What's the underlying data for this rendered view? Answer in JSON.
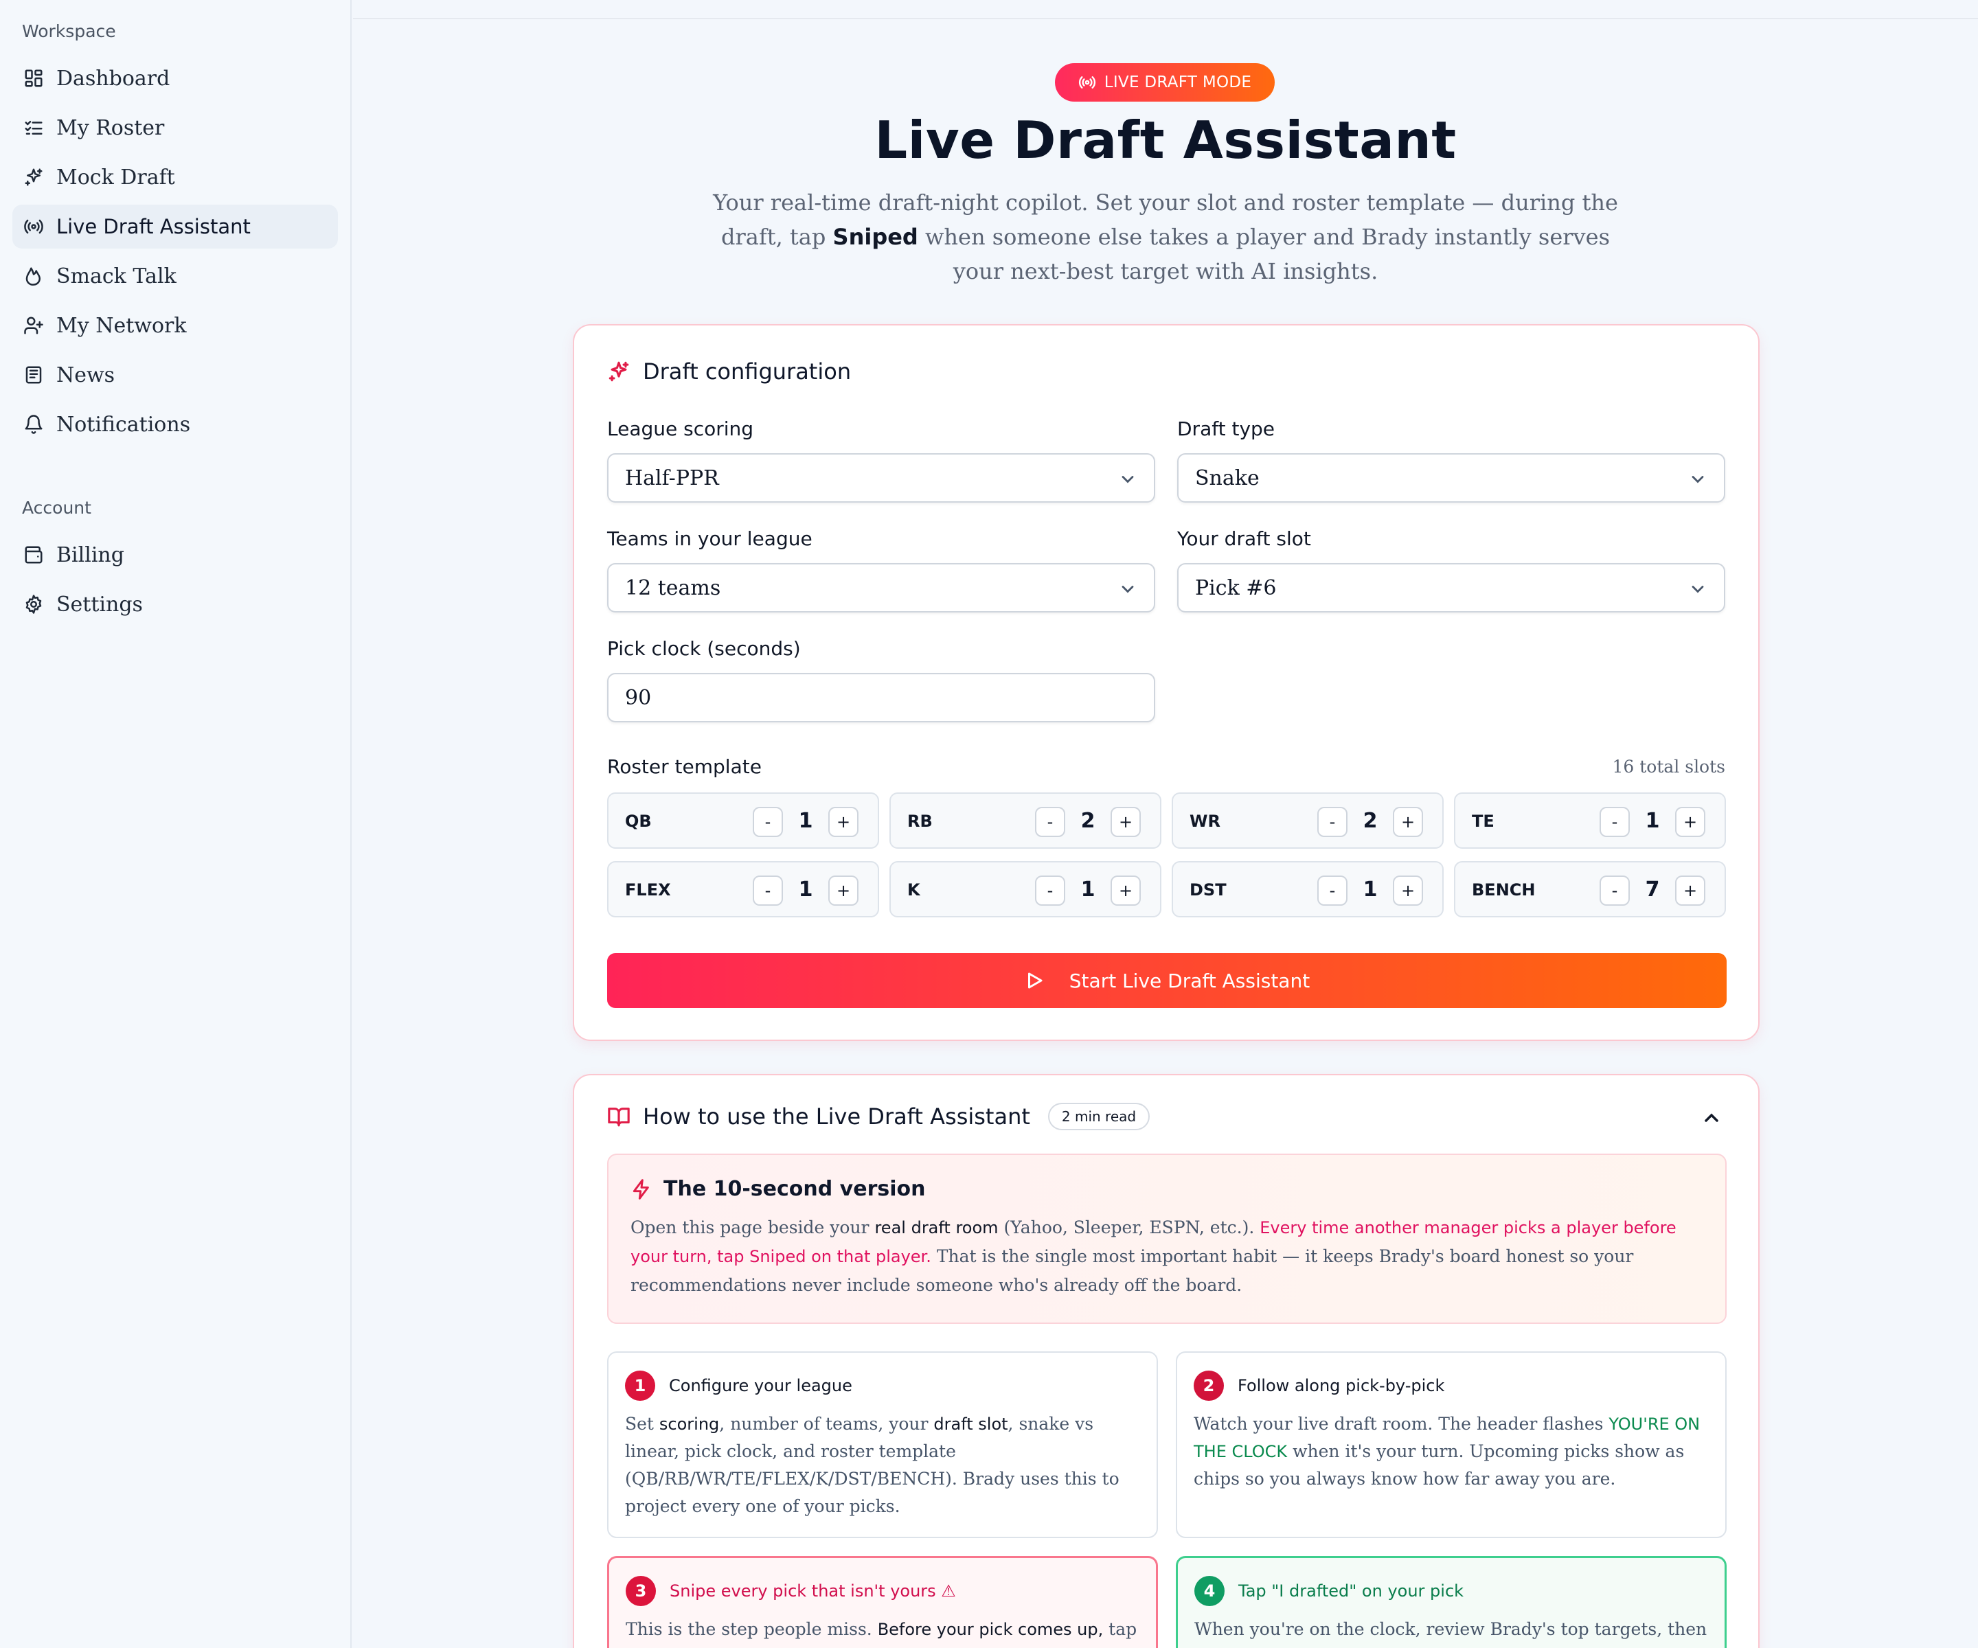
{
  "sidebar": {
    "workspace_label": "Workspace",
    "workspace_items": [
      {
        "label": "Dashboard",
        "icon": "dashboard-icon"
      },
      {
        "label": "My Roster",
        "icon": "list-check-icon"
      },
      {
        "label": "Mock Draft",
        "icon": "sparkles-icon"
      },
      {
        "label": "Live Draft Assistant",
        "icon": "broadcast-icon",
        "active": true
      },
      {
        "label": "Smack Talk",
        "icon": "flame-icon"
      },
      {
        "label": "My Network",
        "icon": "user-plus-icon"
      },
      {
        "label": "News",
        "icon": "newspaper-icon"
      },
      {
        "label": "Notifications",
        "icon": "bell-icon"
      }
    ],
    "account_label": "Account",
    "account_items": [
      {
        "label": "Billing",
        "icon": "wallet-icon"
      },
      {
        "label": "Settings",
        "icon": "gear-icon"
      }
    ]
  },
  "hero": {
    "badge": "LIVE DRAFT MODE",
    "title": "Live Draft Assistant",
    "subtitle_1": "Your real-time draft-night copilot. Set your slot and roster template — during the draft, tap ",
    "subtitle_bold": "Sniped",
    "subtitle_2": " when someone else takes a player and Brady instantly serves your next-best target with AI insights."
  },
  "config": {
    "title": "Draft configuration",
    "league_scoring_label": "League scoring",
    "league_scoring_value": "Half-PPR",
    "draft_type_label": "Draft type",
    "draft_type_value": "Snake",
    "teams_label": "Teams in your league",
    "teams_value": "12 teams",
    "slot_label": "Your draft slot",
    "slot_value": "Pick #6",
    "clock_label": "Pick clock (seconds)",
    "clock_value": "90",
    "roster_label": "Roster template",
    "roster_total": "16 total slots",
    "minus": "-",
    "plus": "+",
    "roster": [
      {
        "pos": "QB",
        "count": "1"
      },
      {
        "pos": "RB",
        "count": "2"
      },
      {
        "pos": "WR",
        "count": "2"
      },
      {
        "pos": "TE",
        "count": "1"
      },
      {
        "pos": "FLEX",
        "count": "1"
      },
      {
        "pos": "K",
        "count": "1"
      },
      {
        "pos": "DST",
        "count": "1"
      },
      {
        "pos": "BENCH",
        "count": "7"
      }
    ],
    "start_label": "Start Live Draft Assistant"
  },
  "guide": {
    "title": "How to use the Live Draft Assistant",
    "read_time": "2 min read",
    "tldr_title": "The 10-second version",
    "tldr_1": "Open this page beside your ",
    "tldr_bold": "real draft room",
    "tldr_2": " (Yahoo, Sleeper, ESPN, etc.). ",
    "tldr_red": "Every time another manager picks a player before your turn, tap Sniped on that player.",
    "tldr_3": " That is the single most important habit — it keeps Brady's board honest so your recommendations never include someone who's already off the board.",
    "steps": [
      {
        "num": "1",
        "title": "Configure your league",
        "b1": "Set ",
        "k1": "scoring",
        "b2": ", number of teams, your ",
        "k2": "draft slot",
        "b3": ", snake vs linear, pick clock, and roster template (QB/RB/WR/TE/FLEX/K/DST/BENCH). Brady uses this to project every one of your picks."
      },
      {
        "num": "2",
        "title": "Follow along pick-by-pick",
        "b1": "Watch your live draft room. The header flashes ",
        "k1": "YOU'RE ON THE CLOCK",
        "b2": " when it's your turn. Upcoming picks show as chips so you always know how far away you are."
      },
      {
        "num": "3",
        "title": "Snipe every pick that isn't yours ⚠",
        "b1": "This is the step people miss. ",
        "k1": "Before your pick comes up,",
        "b2": " tap"
      },
      {
        "num": "4",
        "title": "Tap \"I drafted\" on your pick",
        "b1": "When you're on the clock, review Brady's top targets, then"
      }
    ]
  }
}
